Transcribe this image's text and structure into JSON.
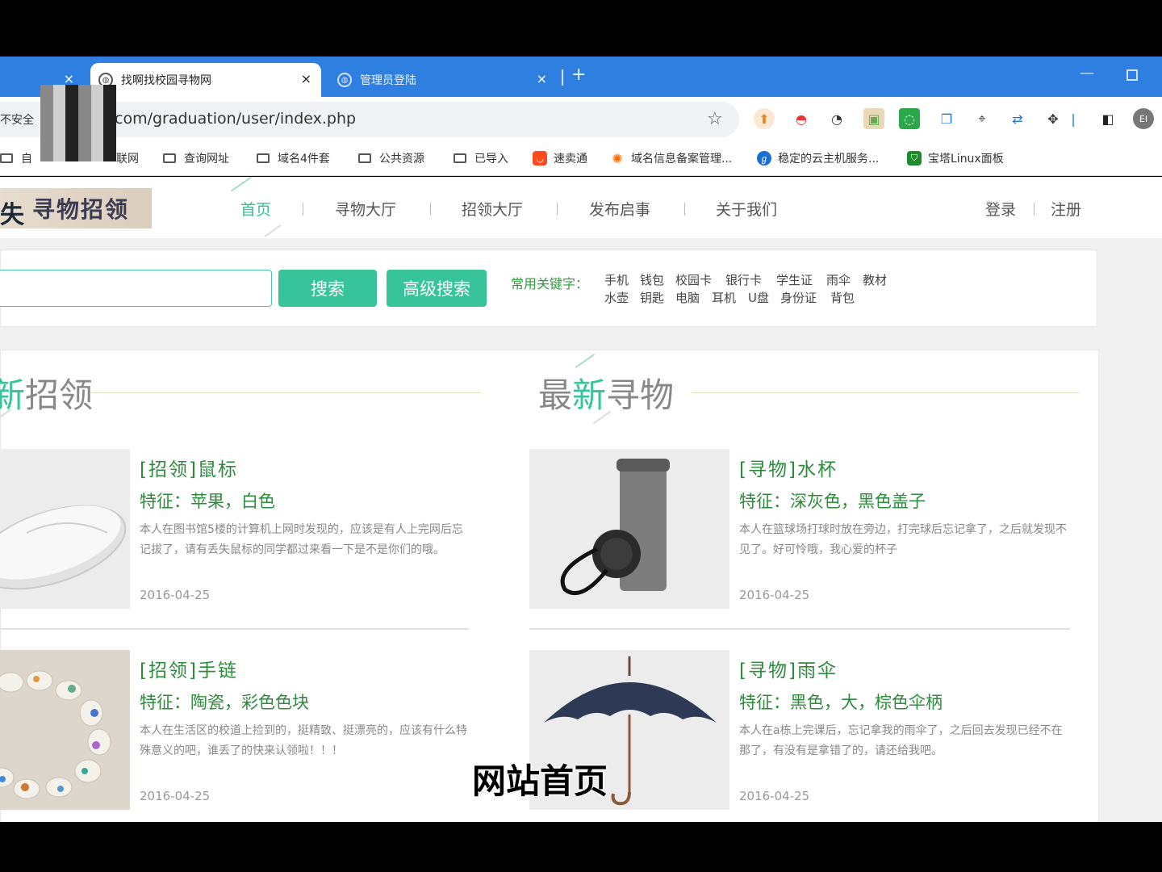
{
  "browser": {
    "tabs": [
      {
        "title": "",
        "close": "×"
      },
      {
        "title": "找啊找校园寻物网",
        "close": "×"
      },
      {
        "title": "管理员登陆",
        "close": "×"
      }
    ],
    "new_tab": "+",
    "window_min": "—",
    "security_label": "不安全",
    "url": "com/graduation/user/index.php",
    "bookmarks": [
      "自",
      "联网",
      "查询网址",
      "域名4件套",
      "公共资源",
      "已导入",
      "速卖通",
      "域名信息备案管理...",
      "稳定的云主机服务...",
      "宝塔Linux面板"
    ],
    "profile_initials": "EI"
  },
  "site": {
    "logo_text": "寻物招领",
    "nav": [
      "首页",
      "寻物大厅",
      "招领大厅",
      "发布启事",
      "关于我们"
    ],
    "login": "登录",
    "register": "注册",
    "search": {
      "placeholder": "",
      "search_button": "搜索",
      "advanced_button": "高级搜索",
      "keywords_label": "常用关键字：",
      "keywords_row1": [
        "手机",
        "钱包",
        "校园卡",
        "银行卡",
        "学生证",
        "雨伞",
        "教材"
      ],
      "keywords_row2": [
        "水壶",
        "钥匙",
        "电脑",
        "耳机",
        "U盘",
        "身份证",
        "背包"
      ]
    },
    "found_section": {
      "title_hl": "新",
      "title_rest": "招领"
    },
    "lost_section": {
      "title_a": "最",
      "title_hl": "新",
      "title_b": "寻物"
    },
    "found_items": [
      {
        "title": "[招领]鼠标",
        "feature": "特征：苹果，白色",
        "desc": "本人在图书馆5楼的计算机上网时发现的，应该是有人上完网后忘记拔了，请有丢失鼠标的同学都过来看一下是不是你们的哦。",
        "date": "2016-04-25"
      },
      {
        "title": "[招领]手链",
        "feature": "特征：陶瓷，彩色色块",
        "desc": "本人在生活区的校道上捡到的，挺精致、挺漂亮的，应该有什么特殊意义的吧，谁丢了的快来认领啦！！！",
        "date": "2016-04-25"
      }
    ],
    "lost_items": [
      {
        "title": "[寻物]水杯",
        "feature": "特征：深灰色，黑色盖子",
        "desc": "本人在篮球场打球时放在旁边，打完球后忘记拿了，之后就发现不见了。好可怜哦，我心爱的杯子",
        "date": "2016-04-25"
      },
      {
        "title": "[寻物]雨伞",
        "feature": "特征：黑色，大，棕色伞柄",
        "desc": "本人在a栋上完课后，忘记拿我的雨伞了，之后回去发现已经不在那了，有没有是拿错了的，请还给我吧。",
        "date": "2016-04-25"
      }
    ]
  },
  "subtitle": "网站首页",
  "colors": {
    "accent": "#38c49b",
    "text_green": "#2e8b3b",
    "chrome_blue": "#2f7fe0"
  }
}
